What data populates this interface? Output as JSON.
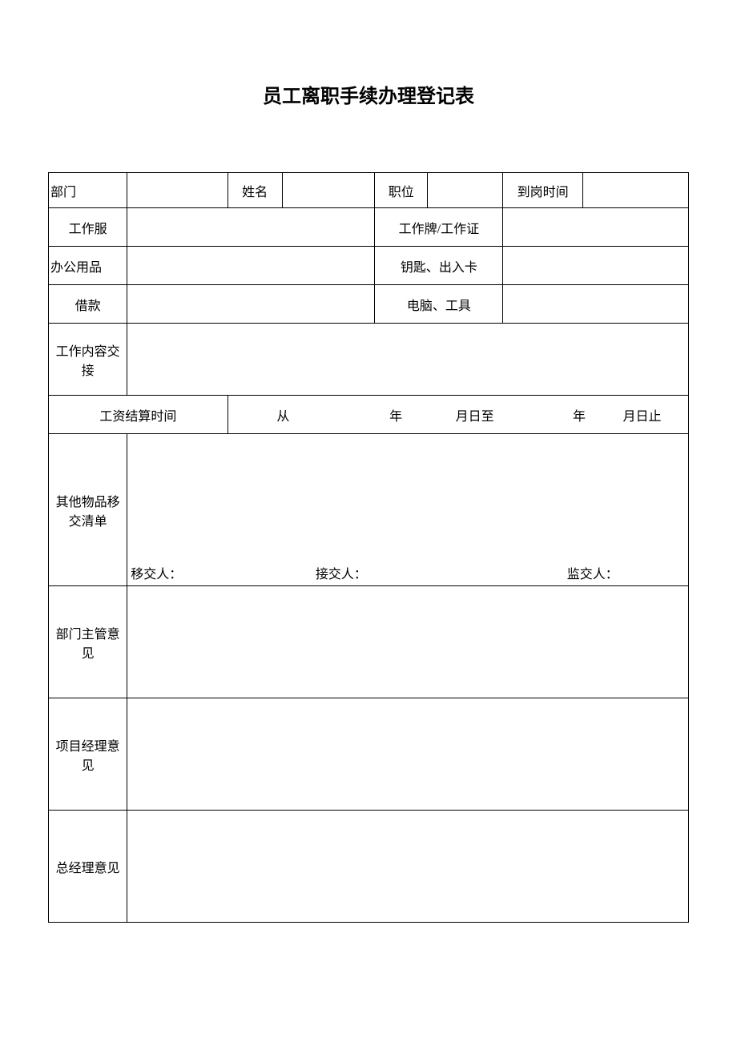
{
  "title": "员工离职手续办理登记表",
  "row1": {
    "dept_label": "部门",
    "dept_value": "",
    "name_label": "姓名",
    "name_value": "",
    "position_label": "职位",
    "position_value": "",
    "arrival_label": "到岗时间",
    "arrival_value": ""
  },
  "row2": {
    "uniform_label": "工作服",
    "uniform_value": "",
    "badge_label": "工作牌/工作证",
    "badge_value": ""
  },
  "row3": {
    "supplies_label": "办公用品",
    "supplies_value": "",
    "keys_label": "钥匙、出入卡",
    "keys_value": ""
  },
  "row4": {
    "loan_label": "借款",
    "loan_value": "",
    "computer_label": "电脑、工具",
    "computer_value": ""
  },
  "row5": {
    "handover_label": "工作内容交接",
    "handover_value": ""
  },
  "row6": {
    "salary_label": "工资结算时间",
    "from": "从",
    "year1": "年",
    "month_to": "月日至",
    "year2": "年",
    "month_end": "月日止"
  },
  "row7": {
    "other_items_label": "其他物品移交清单",
    "transfer_person": "移交人：",
    "receive_person": "接交人：",
    "supervise_person": "监交人："
  },
  "row8": {
    "dept_head_label": "部门主管意见",
    "dept_head_value": ""
  },
  "row9": {
    "pm_label": "项目经理意见",
    "pm_value": ""
  },
  "row10": {
    "gm_label": "总经理意见",
    "gm_value": ""
  }
}
